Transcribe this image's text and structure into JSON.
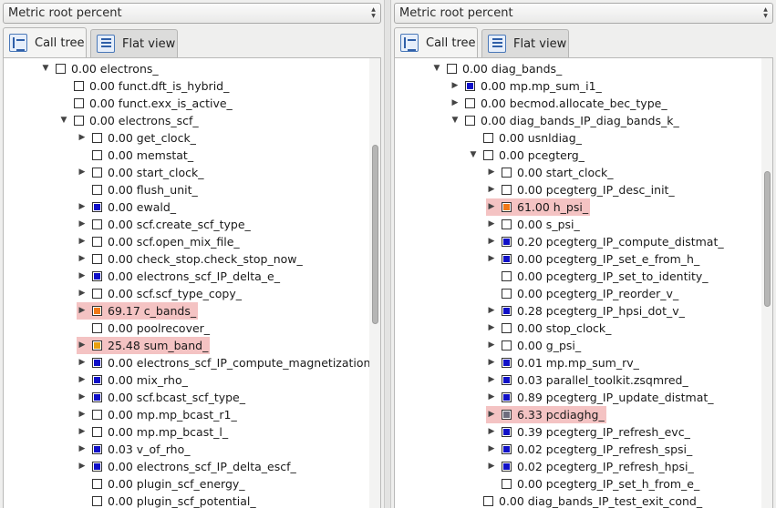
{
  "left": {
    "metric": "Metric root percent",
    "tabs": [
      {
        "label": "Call tree",
        "icon": "call-tree-icon"
      },
      {
        "label": "Flat view",
        "icon": "flat-view-icon"
      }
    ],
    "scrollbar": {
      "position": 0.32,
      "visible_fraction": 0.4
    },
    "rows": [
      {
        "indent": 2,
        "exp": "open",
        "mark": "none",
        "value": "0.00",
        "name": "electrons_"
      },
      {
        "indent": 3,
        "exp": "",
        "mark": "none",
        "value": "0.00",
        "name": "funct.dft_is_hybrid_"
      },
      {
        "indent": 3,
        "exp": "",
        "mark": "none",
        "value": "0.00",
        "name": "funct.exx_is_active_"
      },
      {
        "indent": 3,
        "exp": "open",
        "mark": "none",
        "value": "0.00",
        "name": "electrons_scf_"
      },
      {
        "indent": 4,
        "exp": "closed",
        "mark": "none",
        "value": "0.00",
        "name": "get_clock_"
      },
      {
        "indent": 4,
        "exp": "",
        "mark": "none",
        "value": "0.00",
        "name": "memstat_"
      },
      {
        "indent": 4,
        "exp": "closed",
        "mark": "none",
        "value": "0.00",
        "name": "start_clock_"
      },
      {
        "indent": 4,
        "exp": "",
        "mark": "none",
        "value": "0.00",
        "name": "flush_unit_"
      },
      {
        "indent": 4,
        "exp": "closed",
        "mark": "blue",
        "value": "0.00",
        "name": "ewald_"
      },
      {
        "indent": 4,
        "exp": "closed",
        "mark": "none",
        "value": "0.00",
        "name": "scf.create_scf_type_"
      },
      {
        "indent": 4,
        "exp": "closed",
        "mark": "none",
        "value": "0.00",
        "name": "scf.open_mix_file_"
      },
      {
        "indent": 4,
        "exp": "closed",
        "mark": "none",
        "value": "0.00",
        "name": "check_stop.check_stop_now_"
      },
      {
        "indent": 4,
        "exp": "closed",
        "mark": "blue",
        "value": "0.00",
        "name": "electrons_scf_IP_delta_e_"
      },
      {
        "indent": 4,
        "exp": "closed",
        "mark": "none",
        "value": "0.00",
        "name": "scf.scf_type_copy_"
      },
      {
        "indent": 4,
        "exp": "closed",
        "mark": "orange",
        "value": "69.17",
        "name": "c_bands_",
        "highlight": true
      },
      {
        "indent": 4,
        "exp": "",
        "mark": "none",
        "value": "0.00",
        "name": "poolrecover_"
      },
      {
        "indent": 4,
        "exp": "closed",
        "mark": "amber",
        "value": "25.48",
        "name": "sum_band_",
        "highlight": true
      },
      {
        "indent": 4,
        "exp": "closed",
        "mark": "blue",
        "value": "0.00",
        "name": "electrons_scf_IP_compute_magnetization_"
      },
      {
        "indent": 4,
        "exp": "closed",
        "mark": "blue",
        "value": "0.00",
        "name": "mix_rho_"
      },
      {
        "indent": 4,
        "exp": "closed",
        "mark": "blue",
        "value": "0.00",
        "name": "scf.bcast_scf_type_"
      },
      {
        "indent": 4,
        "exp": "closed",
        "mark": "none",
        "value": "0.00",
        "name": "mp.mp_bcast_r1_"
      },
      {
        "indent": 4,
        "exp": "closed",
        "mark": "none",
        "value": "0.00",
        "name": "mp.mp_bcast_l_"
      },
      {
        "indent": 4,
        "exp": "closed",
        "mark": "blue",
        "value": "0.03",
        "name": "v_of_rho_"
      },
      {
        "indent": 4,
        "exp": "closed",
        "mark": "blue",
        "value": "0.00",
        "name": "electrons_scf_IP_delta_escf_"
      },
      {
        "indent": 4,
        "exp": "",
        "mark": "none",
        "value": "0.00",
        "name": "plugin_scf_energy_"
      },
      {
        "indent": 4,
        "exp": "",
        "mark": "none",
        "value": "0.00",
        "name": "plugin_scf_potential_"
      }
    ]
  },
  "right": {
    "metric": "Metric root percent",
    "tabs": [
      {
        "label": "Call tree",
        "icon": "call-tree-icon"
      },
      {
        "label": "Flat view",
        "icon": "flat-view-icon"
      }
    ],
    "scrollbar": {
      "position": 0.36,
      "visible_fraction": 0.3
    },
    "rows": [
      {
        "indent": 2,
        "exp": "open",
        "mark": "none",
        "value": "0.00",
        "name": "diag_bands_"
      },
      {
        "indent": 3,
        "exp": "closed",
        "mark": "blue",
        "value": "0.00",
        "name": "mp.mp_sum_i1_"
      },
      {
        "indent": 3,
        "exp": "closed",
        "mark": "none",
        "value": "0.00",
        "name": "becmod.allocate_bec_type_"
      },
      {
        "indent": 3,
        "exp": "open",
        "mark": "none",
        "value": "0.00",
        "name": "diag_bands_IP_diag_bands_k_"
      },
      {
        "indent": 4,
        "exp": "",
        "mark": "none",
        "value": "0.00",
        "name": "usnldiag_"
      },
      {
        "indent": 4,
        "exp": "open",
        "mark": "none",
        "value": "0.00",
        "name": "pcegterg_"
      },
      {
        "indent": 5,
        "exp": "closed",
        "mark": "none",
        "value": "0.00",
        "name": "start_clock_"
      },
      {
        "indent": 5,
        "exp": "closed",
        "mark": "none",
        "value": "0.00",
        "name": "pcegterg_IP_desc_init_"
      },
      {
        "indent": 5,
        "exp": "closed",
        "mark": "orange",
        "value": "61.00",
        "name": "h_psi_",
        "highlight": true
      },
      {
        "indent": 5,
        "exp": "closed",
        "mark": "none",
        "value": "0.00",
        "name": "s_psi_"
      },
      {
        "indent": 5,
        "exp": "closed",
        "mark": "blue",
        "value": "0.20",
        "name": "pcegterg_IP_compute_distmat_"
      },
      {
        "indent": 5,
        "exp": "closed",
        "mark": "blue",
        "value": "0.00",
        "name": "pcegterg_IP_set_e_from_h_"
      },
      {
        "indent": 5,
        "exp": "",
        "mark": "none",
        "value": "0.00",
        "name": "pcegterg_IP_set_to_identity_"
      },
      {
        "indent": 5,
        "exp": "",
        "mark": "none",
        "value": "0.00",
        "name": "pcegterg_IP_reorder_v_"
      },
      {
        "indent": 5,
        "exp": "closed",
        "mark": "blue",
        "value": "0.28",
        "name": "pcegterg_IP_hpsi_dot_v_"
      },
      {
        "indent": 5,
        "exp": "closed",
        "mark": "none",
        "value": "0.00",
        "name": "stop_clock_"
      },
      {
        "indent": 5,
        "exp": "closed",
        "mark": "none",
        "value": "0.00",
        "name": "g_psi_"
      },
      {
        "indent": 5,
        "exp": "closed",
        "mark": "blue",
        "value": "0.01",
        "name": "mp.mp_sum_rv_"
      },
      {
        "indent": 5,
        "exp": "closed",
        "mark": "blue",
        "value": "0.03",
        "name": "parallel_toolkit.zsqmred_"
      },
      {
        "indent": 5,
        "exp": "closed",
        "mark": "blue",
        "value": "0.89",
        "name": "pcegterg_IP_update_distmat_"
      },
      {
        "indent": 5,
        "exp": "closed",
        "mark": "gray",
        "value": "6.33",
        "name": "pcdiaghg_",
        "highlight": true
      },
      {
        "indent": 5,
        "exp": "closed",
        "mark": "blue",
        "value": "0.39",
        "name": "pcegterg_IP_refresh_evc_"
      },
      {
        "indent": 5,
        "exp": "closed",
        "mark": "blue",
        "value": "0.02",
        "name": "pcegterg_IP_refresh_spsi_"
      },
      {
        "indent": 5,
        "exp": "closed",
        "mark": "blue",
        "value": "0.02",
        "name": "pcegterg_IP_refresh_hpsi_"
      },
      {
        "indent": 5,
        "exp": "",
        "mark": "none",
        "value": "0.00",
        "name": "pcegterg_IP_set_h_from_e_"
      },
      {
        "indent": 4,
        "exp": "",
        "mark": "none",
        "value": "0.00",
        "name": "diag_bands_IP_test_exit_cond_"
      }
    ]
  }
}
